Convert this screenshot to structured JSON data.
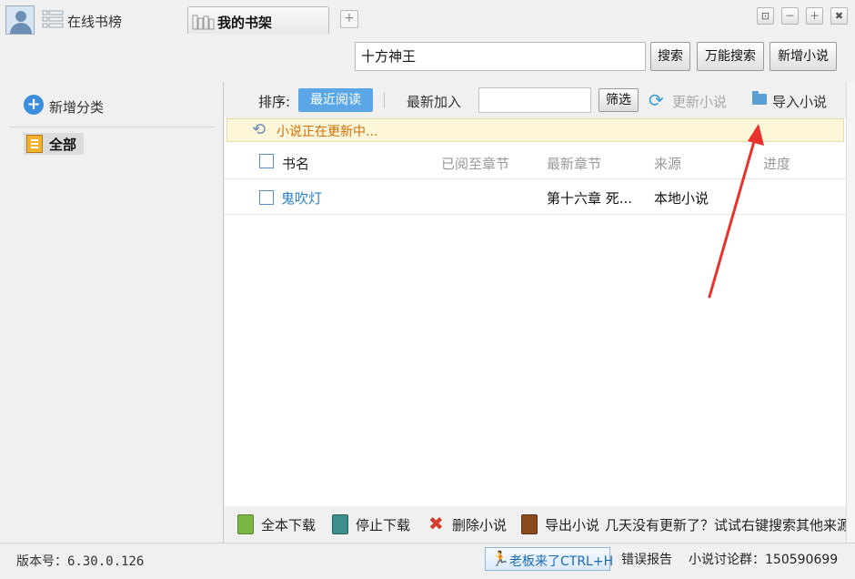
{
  "header": {
    "online_rank_label": "在线书榜",
    "shelf_tab_label": "我的书架",
    "add_tab_symbol": "+",
    "window_buttons": [
      "⊡",
      "－",
      "＋",
      "✖"
    ]
  },
  "search": {
    "value": "十方神王",
    "search_button": "搜索",
    "universal_search_button": "万能搜索",
    "add_novel_button": "新增小说"
  },
  "sidebar": {
    "add_category_label": "新增分类",
    "categories": [
      {
        "label": "全部",
        "selected": true
      }
    ]
  },
  "toolbar": {
    "sort_label": "排序:",
    "sort_recent": "最近阅读",
    "sort_newest": "最新加入",
    "filter_value": "",
    "filter_button": "筛选",
    "update_button": "更新小说",
    "import_button": "导入小说"
  },
  "notice": {
    "text": "小说正在更新中..."
  },
  "table": {
    "columns": [
      "书名",
      "已阅至章节",
      "最新章节",
      "来源",
      "进度"
    ],
    "rows": [
      {
        "title": "鬼吹灯",
        "read_to": "",
        "latest_chapter": "第十六章 死...",
        "source": "本地小说",
        "progress": ""
      }
    ]
  },
  "bottom_bar": {
    "download_all": "全本下载",
    "stop_download": "停止下载",
    "delete_novel": "删除小说",
    "export_novel": "导出小说",
    "hint": "几天没有更新了？试试右键搜索其他来源"
  },
  "status_bar": {
    "version": "版本号：6.30.0.126",
    "boss_key": "老板来了CTRL+H",
    "error_report": "错误报告",
    "group": "小说讨论群：150590699"
  },
  "colors": {
    "accent_blue": "#5aa6e6",
    "link_blue": "#2a7fc6",
    "notice_orange": "#d0700a",
    "annotation_red": "#e8312a"
  }
}
